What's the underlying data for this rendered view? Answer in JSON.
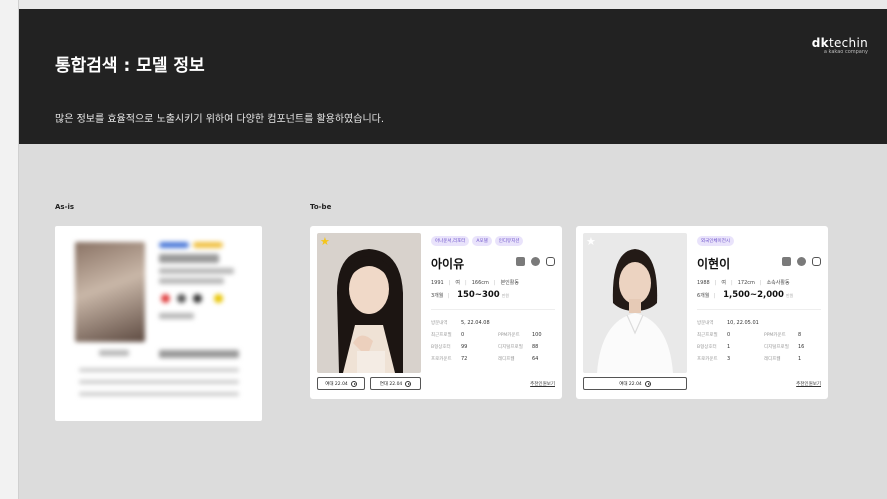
{
  "header": {
    "title": "통합검색 : 모델 정보",
    "description": "많은 정보를 효율적으로 노출시키기 위하여 다양한 컴포넌트를 활용하였습니다.",
    "logo_brand_bold": "dk",
    "logo_brand": "techin",
    "logo_sub": "a kakao company"
  },
  "sections": {
    "asis_label": "As-is",
    "tobe_label": "To-be"
  },
  "cards": [
    {
      "tags": [
        "아나운서,리포터",
        "A모델",
        "인디뮤지션"
      ],
      "name": "아이유",
      "meta": [
        "1991",
        "여",
        "166cm",
        "본인활동"
      ],
      "period": "3개월",
      "price": "150~300",
      "unit": "만원",
      "stats": {
        "recent_label": "방문내역",
        "recent_value": "5, 22.04.08",
        "r1": [
          "최근프로필",
          "0",
          "PPM카운트",
          "100"
        ],
        "r2": [
          "B형상호터",
          "99",
          "디지털프로필",
          "88"
        ],
        "r3": [
          "프로카운트",
          "72",
          "레디프웹",
          "64"
        ]
      },
      "buttons": [
        "여대 22.04",
        "연대 22.04"
      ],
      "more": "추천인원보기",
      "star_color": "#f5c518"
    },
    {
      "tags": [
        "외국인체이전시"
      ],
      "name": "이현이",
      "meta": [
        "1988",
        "여",
        "172cm",
        "소속사활동"
      ],
      "period": "6개월",
      "price": "1,500~2,000",
      "unit": "만원",
      "stats": {
        "recent_label": "방문내역",
        "recent_value": "10, 22.05.01",
        "r1": [
          "최근프로필",
          "0",
          "PPM카운트",
          "8"
        ],
        "r2": [
          "B형상호터",
          "1",
          "디지털프로필",
          "16"
        ],
        "r3": [
          "프로카운트",
          "3",
          "레디프웹",
          "1"
        ]
      },
      "buttons": [
        "여대 22.04"
      ],
      "more": "추천인원보기",
      "star_color": "#ffffff"
    }
  ],
  "colors": {
    "header_bg": "#222222",
    "tag_text": "#6a4fc9",
    "tag_bg": "#e9e3fb"
  }
}
